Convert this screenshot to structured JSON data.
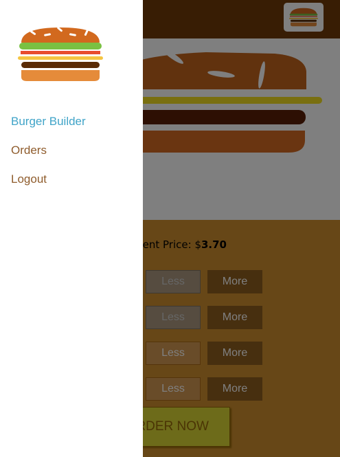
{
  "drawer": {
    "nav": [
      {
        "label": "Burger Builder",
        "active": true
      },
      {
        "label": "Orders",
        "active": false
      },
      {
        "label": "Logout",
        "active": false
      }
    ]
  },
  "controls": {
    "price_prefix": "ent Price: $",
    "price_value": "3.70",
    "less_label": "Less",
    "more_label": "More",
    "rows": [
      {
        "less_disabled": true
      },
      {
        "less_disabled": true
      },
      {
        "less_disabled": false
      },
      {
        "less_disabled": false
      }
    ],
    "order_label": "RDER NOW"
  },
  "colors": {
    "toolbar": "#703b09",
    "controls_bg": "#cf8f2e",
    "link": "#8f5c2c",
    "link_active": "#40a4c8"
  },
  "icons": {
    "logo": "burger-logo-icon"
  }
}
